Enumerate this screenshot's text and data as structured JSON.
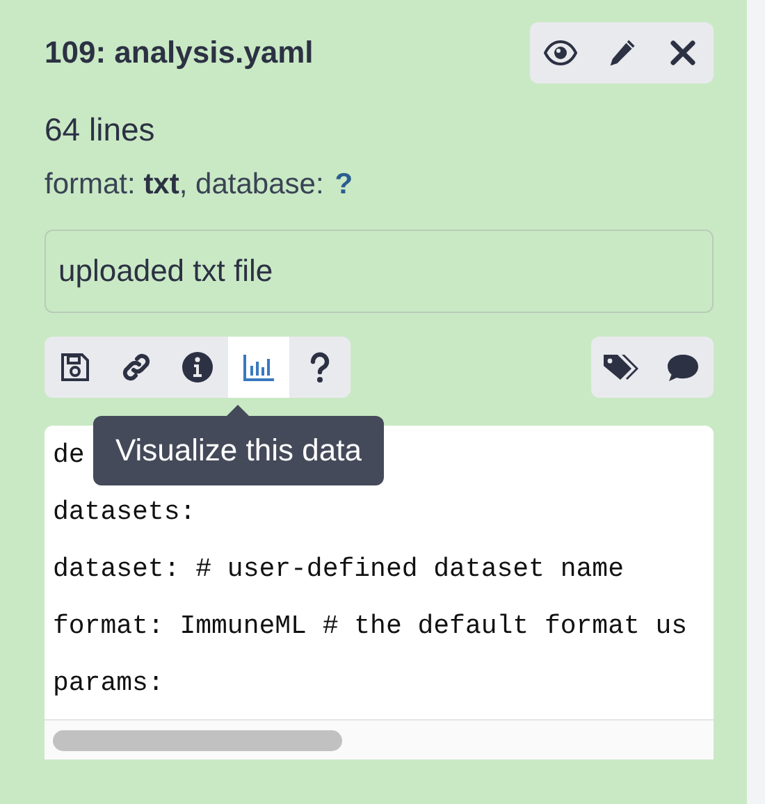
{
  "dataset": {
    "title": "109: analysis.yaml",
    "header_buttons": [
      {
        "kind": "eye"
      },
      {
        "kind": "pencil"
      },
      {
        "kind": "close"
      }
    ],
    "lines": "64 lines",
    "format_line": {
      "text": "format: **txt**, database:",
      "link": "?"
    },
    "description": "uploaded txt file",
    "toolbar_left": [
      {
        "kind": "save",
        "selected": false
      },
      {
        "kind": "link",
        "selected": false
      },
      {
        "kind": "info",
        "selected": false
      },
      {
        "kind": "chart",
        "selected": true
      },
      {
        "kind": "help",
        "selected": false
      }
    ],
    "toolbar_right": [
      {
        "kind": "tags"
      },
      {
        "kind": "comment"
      }
    ],
    "tooltip": "Visualize this data",
    "code_lines": [
      "de",
      "datasets:",
      "dataset: # user-defined dataset name",
      "format: ImmuneML # the default format us",
      "params:"
    ]
  }
}
